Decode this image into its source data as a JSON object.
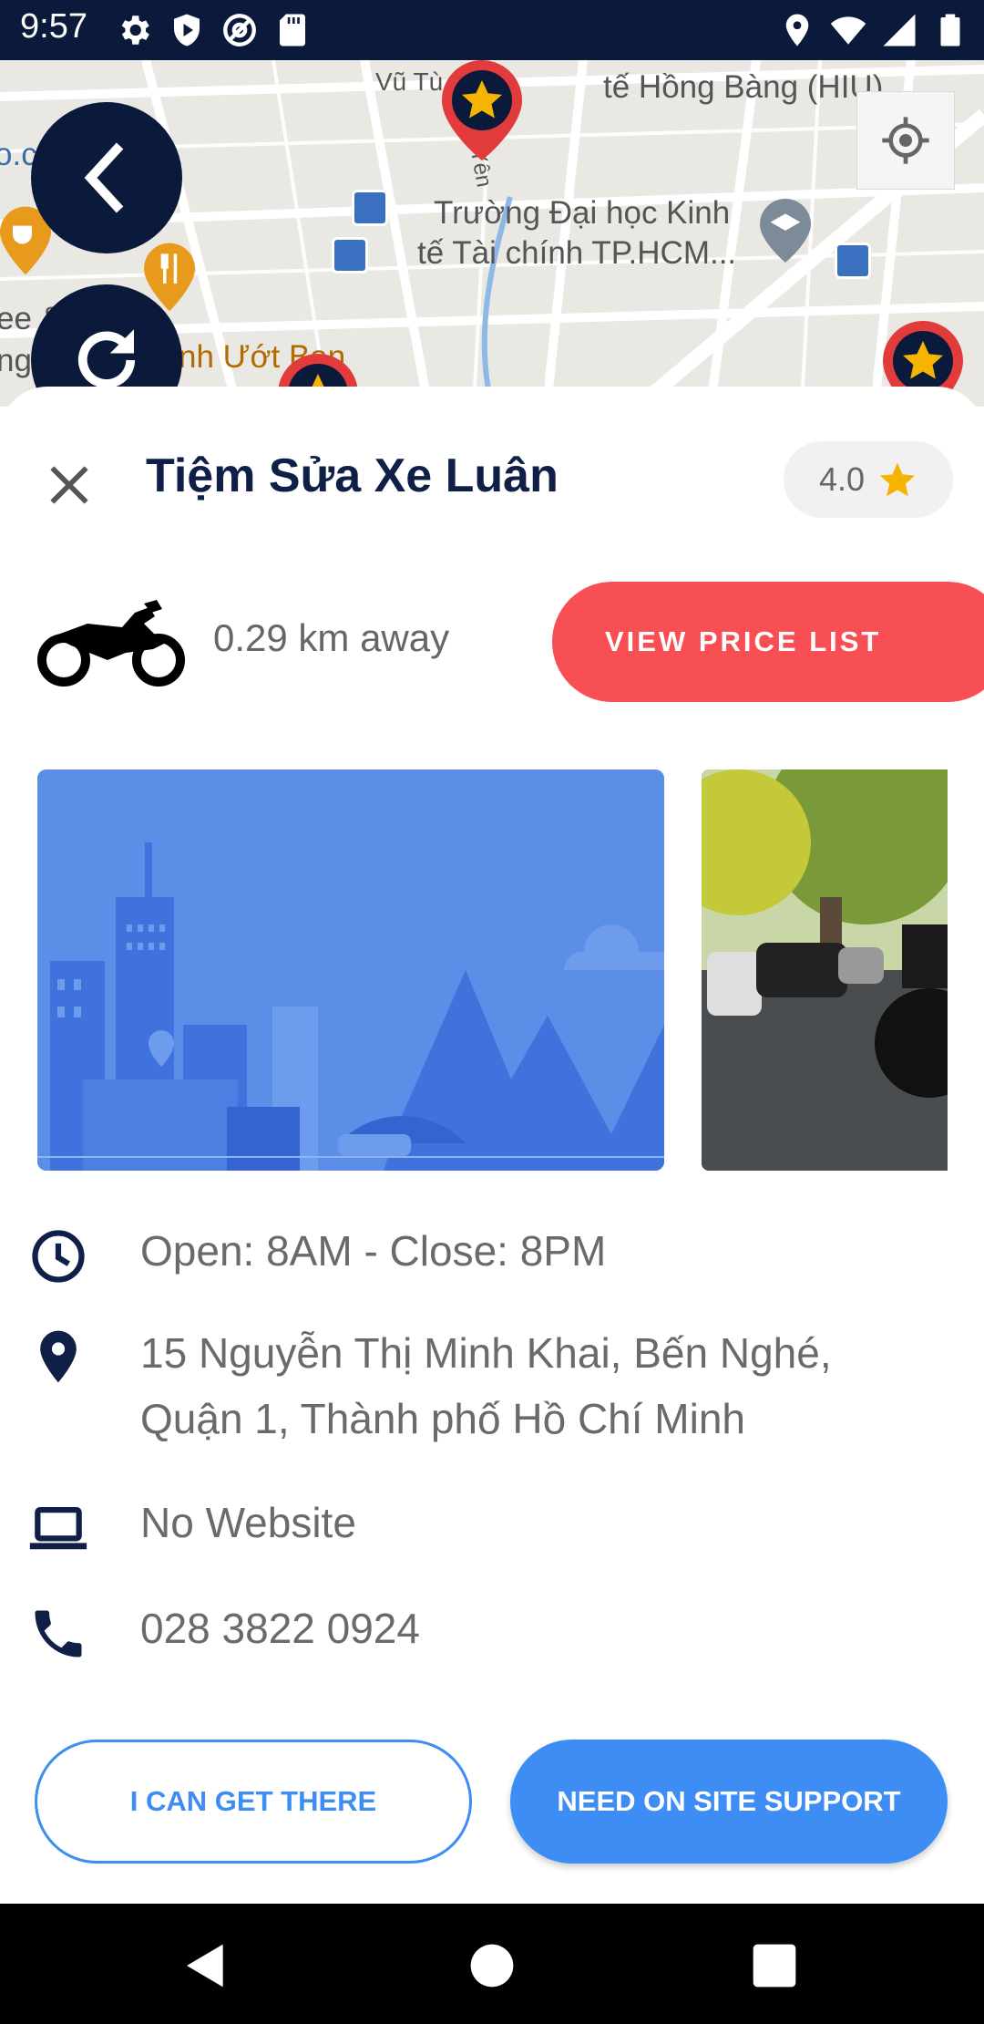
{
  "status_bar": {
    "time": "9:57",
    "left_icons": [
      "settings-icon",
      "shield-play-icon",
      "at-sign-icon",
      "sd-card-icon"
    ],
    "right_icons": [
      "location-icon",
      "wifi-icon",
      "signal-icon",
      "battery-icon"
    ]
  },
  "map": {
    "labels": {
      "vu_tung": "Vũ Tù",
      "hong_bang": "tế Hồng Bàng (HIU)",
      "bach_mieu": "o.c ach Miễu",
      "university_line1": "Trường Đại học Kinh",
      "university_line2": "tế Tài chính TP.HCM...",
      "uot_ban": "nh Ướt Ban",
      "yen": "Yên",
      "ee": "ee &",
      "ng": "ng"
    },
    "buttons": {
      "back": "back-icon",
      "refresh": "refresh-icon",
      "locate": "my-location-icon"
    }
  },
  "shop": {
    "name": "Tiệm Sửa Xe Luân",
    "rating": "4.0",
    "distance": "0.29 km away",
    "view_price_label": "VIEW PRICE LIST",
    "hours": "Open: 8AM - Close: 8PM",
    "address": "15 Nguyễn Thị Minh Khai, Bến Nghé, Quận 1, Thành phố Hồ Chí Minh",
    "website": "No Website",
    "phone": "028 3822 0924"
  },
  "actions": {
    "get_there_label": "I CAN GET THERE",
    "support_label": "NEED ON SITE SUPPORT"
  },
  "colors": {
    "navy": "#0b1a3a",
    "title": "#0f1f47",
    "red": "#f84f55",
    "blue": "#3d8df4",
    "star": "#f5b400"
  }
}
